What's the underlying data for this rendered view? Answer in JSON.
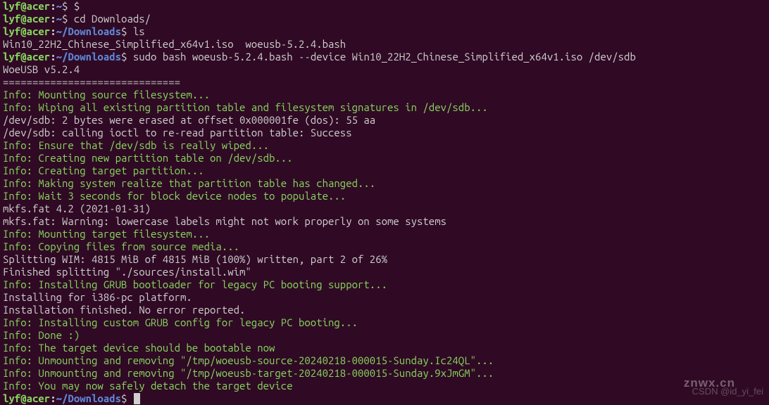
{
  "prompt": {
    "user": "lyf",
    "at": "@",
    "host": "acer",
    "colon": ":",
    "home_path": "~",
    "downloads_path": "~/Downloads",
    "dollar": "$"
  },
  "lines": [
    {
      "type": "prompt",
      "path": "~",
      "cmd": " $"
    },
    {
      "type": "prompt",
      "path": "~",
      "cmd": " cd Downloads/"
    },
    {
      "type": "prompt",
      "path": "~/Downloads",
      "cmd": " ls"
    },
    {
      "type": "output",
      "text": "Win10_22H2_Chinese_Simplified_x64v1.iso  woeusb-5.2.4.bash"
    },
    {
      "type": "prompt",
      "path": "~/Downloads",
      "cmd": " sudo bash woeusb-5.2.4.bash --device Win10_22H2_Chinese_Simplified_x64v1.iso /dev/sdb"
    },
    {
      "type": "output",
      "text": "WoeUSB v5.2.4"
    },
    {
      "type": "output",
      "text": "=============================="
    },
    {
      "type": "info",
      "text": "Info: Mounting source filesystem..."
    },
    {
      "type": "info",
      "text": "Info: Wiping all existing partition table and filesystem signatures in /dev/sdb..."
    },
    {
      "type": "output",
      "text": "/dev/sdb: 2 bytes were erased at offset 0x000001fe (dos): 55 aa"
    },
    {
      "type": "output",
      "text": "/dev/sdb: calling ioctl to re-read partition table: Success"
    },
    {
      "type": "info",
      "text": "Info: Ensure that /dev/sdb is really wiped..."
    },
    {
      "type": "info",
      "text": "Info: Creating new partition table on /dev/sdb..."
    },
    {
      "type": "info",
      "text": "Info: Creating target partition..."
    },
    {
      "type": "info",
      "text": "Info: Making system realize that partition table has changed..."
    },
    {
      "type": "info",
      "text": "Info: Wait 3 seconds for block device nodes to populate..."
    },
    {
      "type": "output",
      "text": "mkfs.fat 4.2 (2021-01-31)"
    },
    {
      "type": "output",
      "text": "mkfs.fat: Warning: lowercase labels might not work properly on some systems"
    },
    {
      "type": "info",
      "text": "Info: Mounting target filesystem..."
    },
    {
      "type": "info",
      "text": "Info: Copying files from source media..."
    },
    {
      "type": "output",
      "text": "Splitting WIM: 4815 MiB of 4815 MiB (100%) written, part 2 of 26%"
    },
    {
      "type": "output",
      "text": "Finished splitting \"./sources/install.wim\""
    },
    {
      "type": "info",
      "text": "Info: Installing GRUB bootloader for legacy PC booting support..."
    },
    {
      "type": "output",
      "text": "Installing for i386-pc platform."
    },
    {
      "type": "output",
      "text": "Installation finished. No error reported."
    },
    {
      "type": "info",
      "text": "Info: Installing custom GRUB config for legacy PC booting..."
    },
    {
      "type": "info",
      "text": "Info: Done :)"
    },
    {
      "type": "info",
      "text": "Info: The target device should be bootable now"
    },
    {
      "type": "info",
      "text": "Info: Unmounting and removing \"/tmp/woeusb-source-20240218-000015-Sunday.Ic24QL\"..."
    },
    {
      "type": "info",
      "text": "Info: Unmounting and removing \"/tmp/woeusb-target-20240218-000015-Sunday.9xJmGM\"..."
    },
    {
      "type": "info",
      "text": "Info: You may now safely detach the target device"
    },
    {
      "type": "prompt_cursor",
      "path": "~/Downloads",
      "cmd": " "
    }
  ],
  "watermark_logo": "znwx.cn",
  "watermark_right": "CSDN @id_yi_fei"
}
